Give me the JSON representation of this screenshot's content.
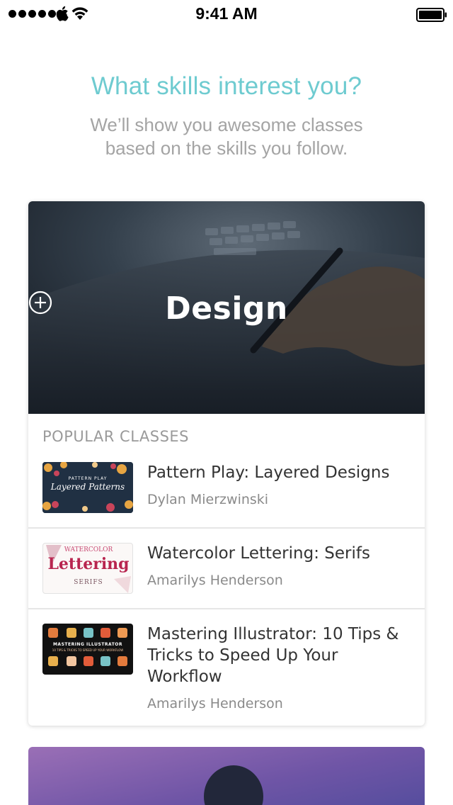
{
  "status_bar": {
    "time": "9:41 AM"
  },
  "header": {
    "title": "What skills interest you?",
    "subtitle": "We’ll show you awesome classes based on the skills you follow."
  },
  "skill_card": {
    "skill_label": "Design",
    "section_label": "POPULAR CLASSES",
    "classes": [
      {
        "title": "Pattern Play: Layered Designs",
        "author": "Dylan Mierzwinski",
        "thumb_text": [
          "PATTERN PLAY",
          "Layered Patterns"
        ]
      },
      {
        "title": "Watercolor Lettering: Serifs",
        "author": "Amarilys Henderson",
        "thumb_text": [
          "WATERCOLOR",
          "Lettering",
          "SERIFS"
        ]
      },
      {
        "title": "Mastering Illustrator: 10 Tips & Tricks to Speed Up Your Workflow",
        "author": "Amarilys Henderson",
        "thumb_text": [
          "MASTERING ILLUSTRATOR",
          "10 TIPS & TRICKS TO SPEED UP YOUR WORKFLOW"
        ]
      }
    ]
  },
  "colors": {
    "accent": "#6ecbd0",
    "subtitle": "#a4a4a4",
    "hero_dark": "#1f2630"
  }
}
